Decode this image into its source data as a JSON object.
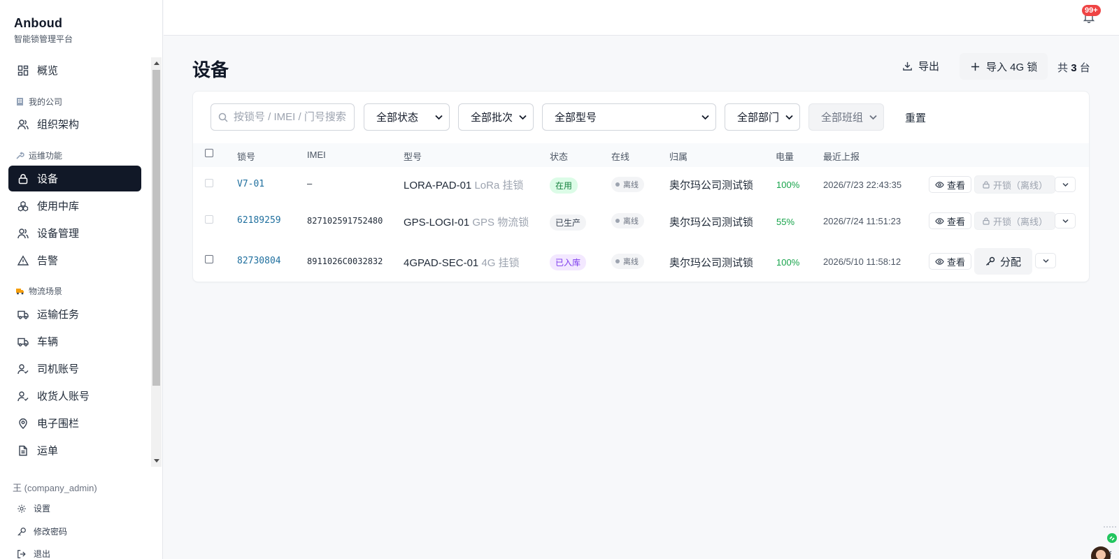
{
  "brand": {
    "title": "Anboud",
    "subtitle": "智能锁管理平台"
  },
  "nav": {
    "overview": "概览",
    "section_company": "我的公司",
    "org": "组织架构",
    "section_ops": "运维功能",
    "devices": "设备",
    "warehouse": "使用中库",
    "device_mgmt": "设备管理",
    "alarms": "告警",
    "section_logistics": "物流场景",
    "transport": "运输任务",
    "vehicles": "车辆",
    "drivers": "司机账号",
    "receivers": "收货人账号",
    "geofence": "电子围栏",
    "waybill": "运单"
  },
  "user": {
    "name": "王 (company_admin)",
    "settings": "设置",
    "change_password": "修改密码",
    "logout": "退出"
  },
  "topbar": {
    "badge": "99+"
  },
  "page": {
    "title": "设备",
    "export": "导出",
    "import": "导入 4G 锁",
    "total_prefix": "共",
    "total_count": "3",
    "total_suffix": "台"
  },
  "filters": {
    "search_placeholder": "按锁号 / IMEI / 门号搜索",
    "status": "全部状态",
    "batch": "全部批次",
    "model": "全部型号",
    "department": "全部部门",
    "team": "全部班组",
    "reset": "重置"
  },
  "table": {
    "headers": {
      "lock": "锁号",
      "imei": "IMEI",
      "model": "型号",
      "status": "状态",
      "online": "在线",
      "owner": "归属",
      "battery": "电量",
      "last_report": "最近上报"
    },
    "rows": [
      {
        "lock": "V7-01",
        "imei": "–",
        "model": "LORA-PAD-01",
        "model_sub": "LoRa 挂锁",
        "status": "在用",
        "online": "离线",
        "owner": "奥尔玛公司测试锁",
        "battery": "100%",
        "last_report": "2026/7/23 22:43:35",
        "view": "查看",
        "action": "开锁（离线）"
      },
      {
        "lock": "62189259",
        "imei": "827102591752480",
        "model": "GPS-LOGI-01",
        "model_sub": "GPS 物流锁",
        "status": "已生产",
        "online": "离线",
        "owner": "奥尔玛公司测试锁",
        "battery": "55%",
        "last_report": "2026/7/24 11:51:23",
        "view": "查看",
        "action": "开锁（离线）"
      },
      {
        "lock": "82730804",
        "imei": "8911026C0032832",
        "model": "4GPAD-SEC-01",
        "model_sub": "4G 挂锁",
        "status": "已入库",
        "online": "离线",
        "owner": "奥尔玛公司测试锁",
        "battery": "100%",
        "last_report": "2026/5/10 11:58:12",
        "view": "查看",
        "action": "分配"
      }
    ]
  },
  "colors": {
    "accent": "#111827",
    "link": "#1f6f9e",
    "battery": "#16a34a",
    "badge": "#ef4444",
    "status_inuse": "#16a34a",
    "status_stored": "#7c3aed"
  }
}
